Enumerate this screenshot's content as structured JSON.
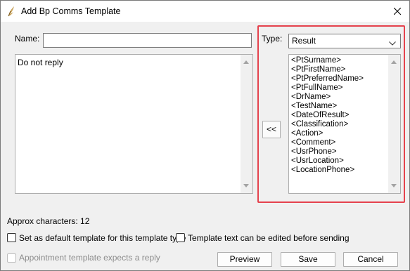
{
  "window": {
    "title": "Add Bp Comms Template"
  },
  "form": {
    "name_label": "Name:",
    "name_value": "",
    "body_text": "Do not reply",
    "type_label": "Type:",
    "type_value": "Result",
    "insert_button": "<<",
    "approx_characters": "Approx characters: 12"
  },
  "fields_list": [
    "<PtSurname>",
    "<PtFirstName>",
    "<PtPreferredName>",
    "<PtFullName>",
    "<DrName>",
    "<TestName>",
    "<DateOfResult>",
    "<Classification>",
    "<Action>",
    "<Comment>",
    "<UsrPhone>",
    "<UsrLocation>",
    "<LocationPhone>"
  ],
  "options": {
    "default_template": "Set as default template for this template type",
    "editable_before_sending": "Template text can be edited before sending",
    "appointment_reply": "Appointment template expects a reply"
  },
  "buttons": {
    "preview": "Preview",
    "save": "Save",
    "cancel": "Cancel"
  },
  "colors": {
    "highlight": "#e5424d"
  }
}
